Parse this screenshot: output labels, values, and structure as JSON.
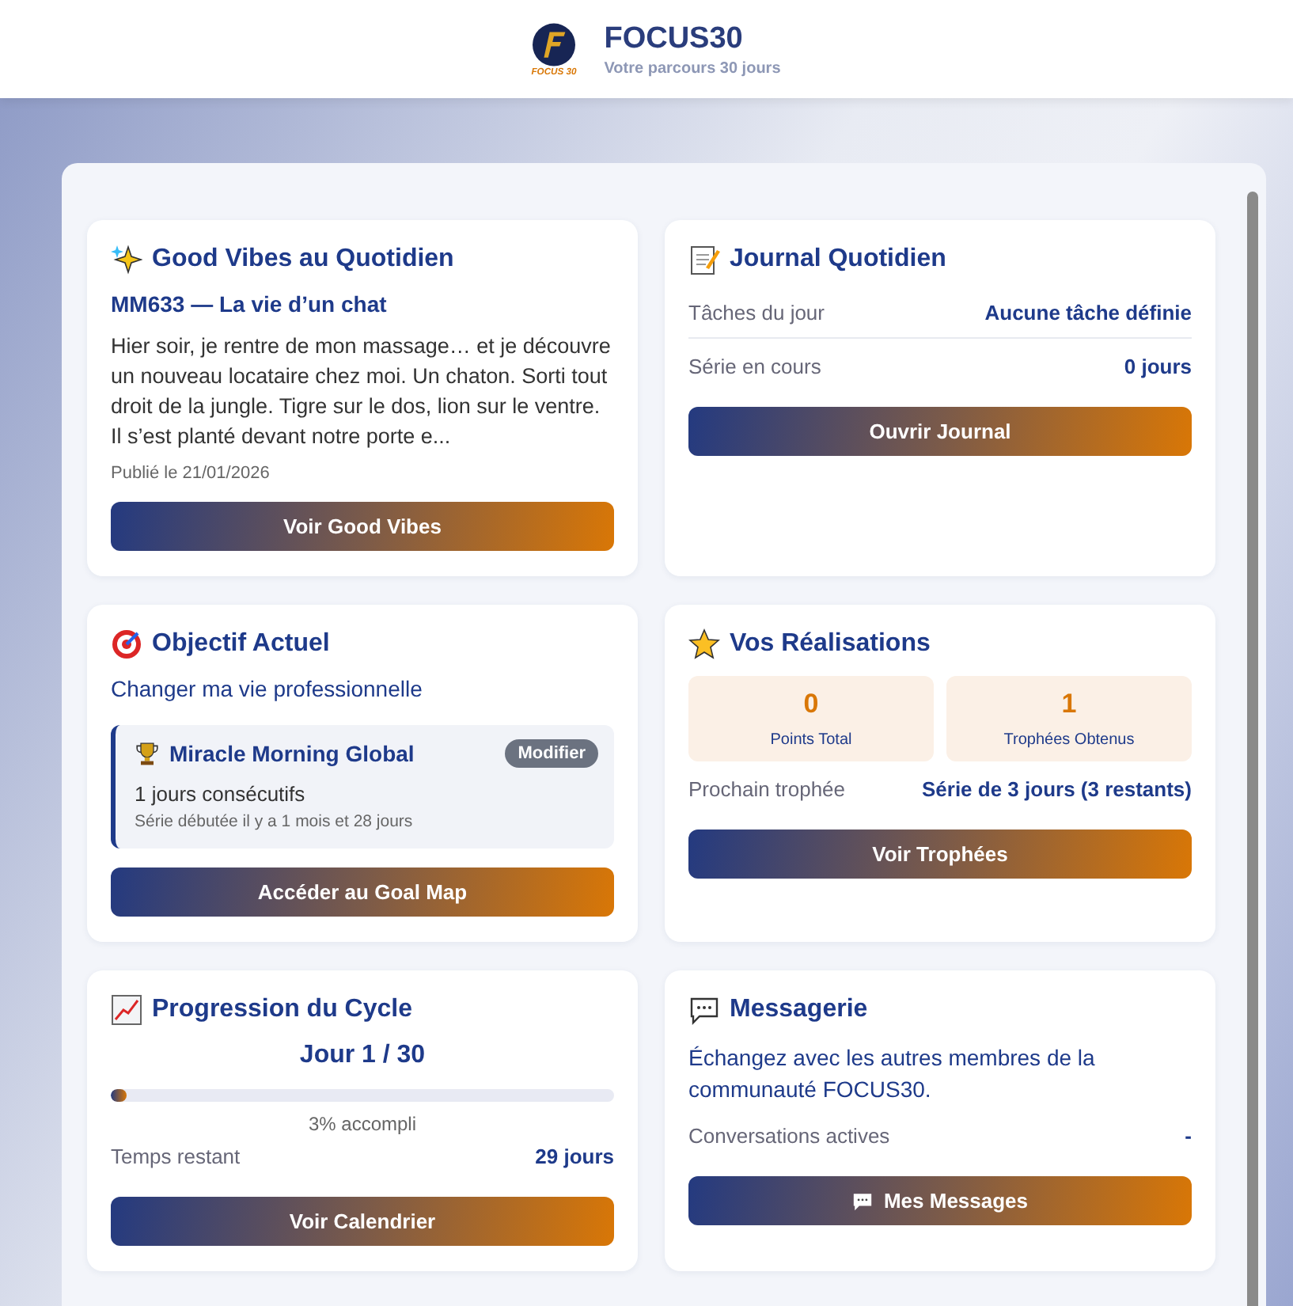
{
  "header": {
    "logo_text": "FOCUS 30",
    "title": "FOCUS30",
    "subtitle": "Votre parcours 30 jours"
  },
  "good_vibes": {
    "title": "Good Vibes au Quotidien",
    "post_title": "MM633 — La vie d’un chat",
    "excerpt": "Hier soir, je rentre de mon massage… et je découvre un nouveau locataire chez moi. Un chaton. Sorti tout droit de la jungle. Tigre sur le dos, lion sur le ventre. Il s’est planté devant notre porte e...",
    "date": "Publié le 21/01/2026",
    "button": "Voir Good Vibes"
  },
  "journal": {
    "title": "Journal Quotidien",
    "rows": [
      {
        "label": "Tâches du jour",
        "value": "Aucune tâche définie"
      },
      {
        "label": "Série en cours",
        "value": "0 jours"
      }
    ],
    "button": "Ouvrir Journal"
  },
  "objective": {
    "title": "Objectif Actuel",
    "goal": "Changer ma vie professionnelle",
    "habit": {
      "name": "Miracle Morning Global",
      "edit": "Modifier",
      "streak": "1 jours consécutifs",
      "since": "Série débutée il y a 1 mois et 28 jours"
    },
    "button": "Accéder au Goal Map"
  },
  "achievements": {
    "title": "Vos Réalisations",
    "stats": [
      {
        "value": "0",
        "label": "Points Total"
      },
      {
        "value": "1",
        "label": "Trophées Obtenus"
      }
    ],
    "next_label": "Prochain trophée",
    "next_value": "Série de 3 jours (3 restants)",
    "button": "Voir Trophées"
  },
  "progress": {
    "title": "Progression du Cycle",
    "day": "Jour 1 / 30",
    "level": 0.03,
    "percent": "3% accompli",
    "remaining_label": "Temps restant",
    "remaining_value": "29 jours",
    "button": "Voir Calendrier"
  },
  "messaging": {
    "title": "Messagerie",
    "text": "Échangez avec les autres membres de la communauté FOCUS30.",
    "row_label": "Conversations actives",
    "row_value": "-",
    "button": "Mes Messages"
  }
}
